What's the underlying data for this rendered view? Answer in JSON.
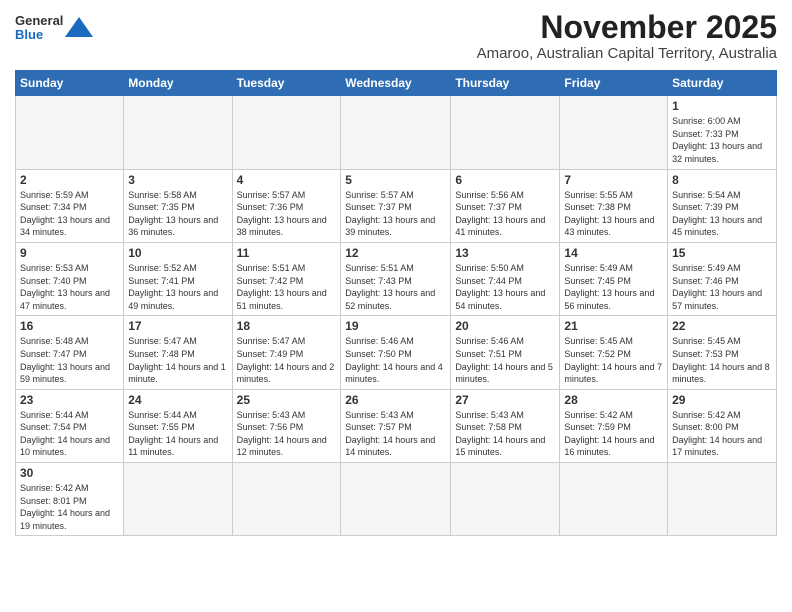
{
  "header": {
    "logo_line1": "General",
    "logo_line2": "Blue",
    "month": "November 2025",
    "location": "Amaroo, Australian Capital Territory, Australia"
  },
  "weekdays": [
    "Sunday",
    "Monday",
    "Tuesday",
    "Wednesday",
    "Thursday",
    "Friday",
    "Saturday"
  ],
  "weeks": [
    [
      {
        "day": "",
        "empty": true
      },
      {
        "day": "",
        "empty": true
      },
      {
        "day": "",
        "empty": true
      },
      {
        "day": "",
        "empty": true
      },
      {
        "day": "",
        "empty": true
      },
      {
        "day": "",
        "empty": true
      },
      {
        "day": "1",
        "sunrise": "6:00 AM",
        "sunset": "7:33 PM",
        "daylight": "13 hours and 32 minutes."
      }
    ],
    [
      {
        "day": "2",
        "sunrise": "5:59 AM",
        "sunset": "7:34 PM",
        "daylight": "13 hours and 34 minutes."
      },
      {
        "day": "3",
        "sunrise": "5:58 AM",
        "sunset": "7:35 PM",
        "daylight": "13 hours and 36 minutes."
      },
      {
        "day": "4",
        "sunrise": "5:57 AM",
        "sunset": "7:36 PM",
        "daylight": "13 hours and 38 minutes."
      },
      {
        "day": "5",
        "sunrise": "5:57 AM",
        "sunset": "7:37 PM",
        "daylight": "13 hours and 39 minutes."
      },
      {
        "day": "6",
        "sunrise": "5:56 AM",
        "sunset": "7:37 PM",
        "daylight": "13 hours and 41 minutes."
      },
      {
        "day": "7",
        "sunrise": "5:55 AM",
        "sunset": "7:38 PM",
        "daylight": "13 hours and 43 minutes."
      },
      {
        "day": "8",
        "sunrise": "5:54 AM",
        "sunset": "7:39 PM",
        "daylight": "13 hours and 45 minutes."
      }
    ],
    [
      {
        "day": "9",
        "sunrise": "5:53 AM",
        "sunset": "7:40 PM",
        "daylight": "13 hours and 47 minutes."
      },
      {
        "day": "10",
        "sunrise": "5:52 AM",
        "sunset": "7:41 PM",
        "daylight": "13 hours and 49 minutes."
      },
      {
        "day": "11",
        "sunrise": "5:51 AM",
        "sunset": "7:42 PM",
        "daylight": "13 hours and 51 minutes."
      },
      {
        "day": "12",
        "sunrise": "5:51 AM",
        "sunset": "7:43 PM",
        "daylight": "13 hours and 52 minutes."
      },
      {
        "day": "13",
        "sunrise": "5:50 AM",
        "sunset": "7:44 PM",
        "daylight": "13 hours and 54 minutes."
      },
      {
        "day": "14",
        "sunrise": "5:49 AM",
        "sunset": "7:45 PM",
        "daylight": "13 hours and 56 minutes."
      },
      {
        "day": "15",
        "sunrise": "5:49 AM",
        "sunset": "7:46 PM",
        "daylight": "13 hours and 57 minutes."
      }
    ],
    [
      {
        "day": "16",
        "sunrise": "5:48 AM",
        "sunset": "7:47 PM",
        "daylight": "13 hours and 59 minutes."
      },
      {
        "day": "17",
        "sunrise": "5:47 AM",
        "sunset": "7:48 PM",
        "daylight": "14 hours and 1 minute."
      },
      {
        "day": "18",
        "sunrise": "5:47 AM",
        "sunset": "7:49 PM",
        "daylight": "14 hours and 2 minutes."
      },
      {
        "day": "19",
        "sunrise": "5:46 AM",
        "sunset": "7:50 PM",
        "daylight": "14 hours and 4 minutes."
      },
      {
        "day": "20",
        "sunrise": "5:46 AM",
        "sunset": "7:51 PM",
        "daylight": "14 hours and 5 minutes."
      },
      {
        "day": "21",
        "sunrise": "5:45 AM",
        "sunset": "7:52 PM",
        "daylight": "14 hours and 7 minutes."
      },
      {
        "day": "22",
        "sunrise": "5:45 AM",
        "sunset": "7:53 PM",
        "daylight": "14 hours and 8 minutes."
      }
    ],
    [
      {
        "day": "23",
        "sunrise": "5:44 AM",
        "sunset": "7:54 PM",
        "daylight": "14 hours and 10 minutes."
      },
      {
        "day": "24",
        "sunrise": "5:44 AM",
        "sunset": "7:55 PM",
        "daylight": "14 hours and 11 minutes."
      },
      {
        "day": "25",
        "sunrise": "5:43 AM",
        "sunset": "7:56 PM",
        "daylight": "14 hours and 12 minutes."
      },
      {
        "day": "26",
        "sunrise": "5:43 AM",
        "sunset": "7:57 PM",
        "daylight": "14 hours and 14 minutes."
      },
      {
        "day": "27",
        "sunrise": "5:43 AM",
        "sunset": "7:58 PM",
        "daylight": "14 hours and 15 minutes."
      },
      {
        "day": "28",
        "sunrise": "5:42 AM",
        "sunset": "7:59 PM",
        "daylight": "14 hours and 16 minutes."
      },
      {
        "day": "29",
        "sunrise": "5:42 AM",
        "sunset": "8:00 PM",
        "daylight": "14 hours and 17 minutes."
      }
    ],
    [
      {
        "day": "30",
        "sunrise": "5:42 AM",
        "sunset": "8:01 PM",
        "daylight": "14 hours and 19 minutes."
      },
      {
        "day": "",
        "empty": true
      },
      {
        "day": "",
        "empty": true
      },
      {
        "day": "",
        "empty": true
      },
      {
        "day": "",
        "empty": true
      },
      {
        "day": "",
        "empty": true
      },
      {
        "day": "",
        "empty": true
      }
    ]
  ]
}
